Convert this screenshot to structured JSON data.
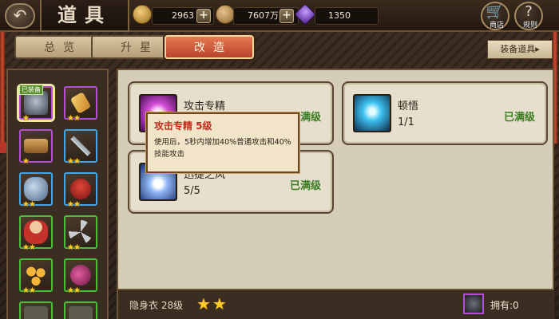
{
  "header": {
    "title": "道具",
    "resources": [
      {
        "icon": "gold-coin-icon",
        "value": "2963"
      },
      {
        "icon": "copper-coin-icon",
        "value": "7607万"
      },
      {
        "icon": "purple-gem-icon",
        "value": "1350"
      }
    ],
    "shop_label": "商店",
    "rules_label": "规则"
  },
  "tabs": [
    {
      "label": "总览",
      "active": false
    },
    {
      "label": "升星",
      "active": false
    },
    {
      "label": "改造",
      "active": true
    }
  ],
  "equip_items_label": "装备道具▸",
  "inventory": {
    "equipped_badge": "已装备",
    "items": [
      {
        "icon": "armor-icon",
        "rarity": "purple",
        "stars": "★",
        "equipped": true
      },
      {
        "icon": "talisman-icon",
        "rarity": "purple",
        "stars": "★★"
      },
      {
        "icon": "scroll-icon",
        "rarity": "purple",
        "stars": "★"
      },
      {
        "icon": "sword-icon",
        "rarity": "blue",
        "stars": "★★"
      },
      {
        "icon": "stone-icon",
        "rarity": "blue",
        "stars": "★★"
      },
      {
        "icon": "red-scarf-icon",
        "rarity": "blue",
        "stars": "★★"
      },
      {
        "icon": "doll-icon",
        "rarity": "green",
        "stars": "★★"
      },
      {
        "icon": "darts-icon",
        "rarity": "green",
        "stars": "★★"
      },
      {
        "icon": "pellets-icon",
        "rarity": "green",
        "stars": "★★"
      },
      {
        "icon": "bomb-icon",
        "rarity": "green",
        "stars": "★★"
      },
      {
        "icon": "item-icon",
        "rarity": "green",
        "stars": ""
      },
      {
        "icon": "item-icon",
        "rarity": "green",
        "stars": ""
      }
    ]
  },
  "skills": [
    {
      "name": "攻击专精",
      "level": "",
      "status": "已满级",
      "icon": "attack-mastery-icon"
    },
    {
      "name": "顿悟",
      "level": "1/1",
      "status": "已满级",
      "icon": "enlightenment-icon"
    },
    {
      "name": "迅捷之风",
      "level": "5/5",
      "status": "已满级",
      "icon": "swift-wind-icon"
    }
  ],
  "tooltip": {
    "title": "攻击专精 5级",
    "body": "使用后，5秒内增加40%普通攻击和40%技能攻击"
  },
  "footer": {
    "item_name": "隐身衣 28级",
    "stars": "★★",
    "owned": "拥有:0"
  }
}
